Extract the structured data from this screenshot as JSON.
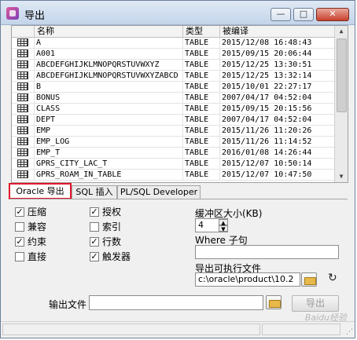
{
  "window": {
    "title": "导出",
    "minimize": "—",
    "maximize": "□",
    "close": "✕"
  },
  "grid": {
    "columns": [
      "名称",
      "类型",
      "被编译"
    ],
    "rows": [
      {
        "name": "A",
        "type": "TABLE",
        "compiled": "2015/12/08 16:48:43"
      },
      {
        "name": "A001",
        "type": "TABLE",
        "compiled": "2015/09/15 20:06:44"
      },
      {
        "name": "ABCDEFGHIJKLMNOPQRSTUVWXYZ",
        "type": "TABLE",
        "compiled": "2015/12/25 13:30:51"
      },
      {
        "name": "ABCDEFGHIJKLMNOPQRSTUVWXYZABCD",
        "type": "TABLE",
        "compiled": "2015/12/25 13:32:14"
      },
      {
        "name": "B",
        "type": "TABLE",
        "compiled": "2015/10/01 22:27:17"
      },
      {
        "name": "BONUS",
        "type": "TABLE",
        "compiled": "2007/04/17 04:52:04"
      },
      {
        "name": "CLASS",
        "type": "TABLE",
        "compiled": "2015/09/15 20:15:56"
      },
      {
        "name": "DEPT",
        "type": "TABLE",
        "compiled": "2007/04/17 04:52:04"
      },
      {
        "name": "EMP",
        "type": "TABLE",
        "compiled": "2015/11/26 11:20:26"
      },
      {
        "name": "EMP_LOG",
        "type": "TABLE",
        "compiled": "2015/11/26 11:14:52"
      },
      {
        "name": "EMP_T",
        "type": "TABLE",
        "compiled": "2016/01/08 14:26:44"
      },
      {
        "name": "GPRS_CITY_LAC_T",
        "type": "TABLE",
        "compiled": "2015/12/07 10:50:14"
      },
      {
        "name": "GPRS_ROAM_IN_TABLE",
        "type": "TABLE",
        "compiled": "2015/12/07 10:47:50"
      }
    ]
  },
  "tabs": [
    "Oracle 导出",
    "SQL 插入",
    "PL/SQL Developer"
  ],
  "options": {
    "compress": {
      "label": "压缩",
      "checked": "✓"
    },
    "compatible": {
      "label": "兼容",
      "checked": ""
    },
    "constraints": {
      "label": "约束",
      "checked": "✓"
    },
    "direct": {
      "label": "直接",
      "checked": ""
    },
    "grants": {
      "label": "授权",
      "checked": "✓"
    },
    "indexes": {
      "label": "索引",
      "checked": ""
    },
    "rows": {
      "label": "行数",
      "checked": "✓"
    },
    "triggers": {
      "label": "触发器",
      "checked": "✓"
    }
  },
  "buffer": {
    "label": "缓冲区大小(KB)",
    "value": "4"
  },
  "where": {
    "label": "Where 子句",
    "value": ""
  },
  "exe": {
    "label": "导出可执行文件",
    "value": "c:\\oracle\\product\\10.2"
  },
  "output": {
    "label": "输出文件",
    "value": ""
  },
  "export_button": "导出",
  "watermark": "Baidu经验",
  "colors": {
    "accent_red": "#e0192a",
    "title_bg": "#c4d5ea"
  }
}
